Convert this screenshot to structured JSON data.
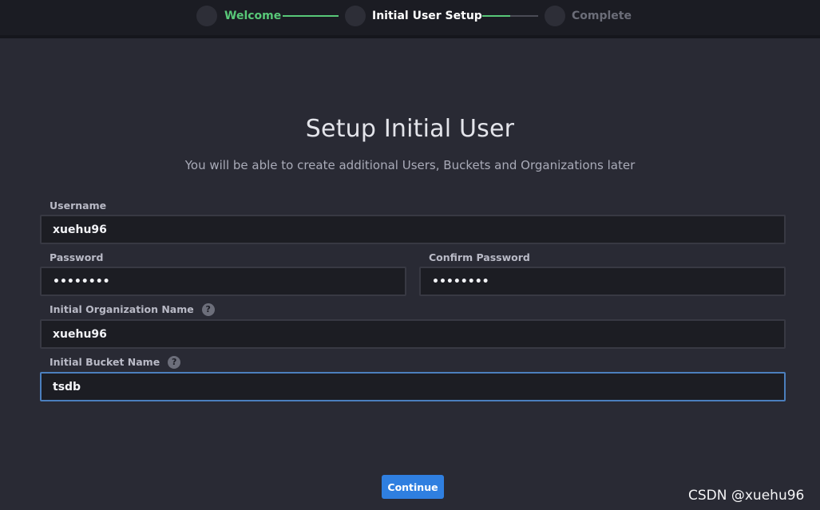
{
  "stepper": {
    "steps": [
      {
        "label": "Welcome",
        "state": "completed"
      },
      {
        "label": "Initial User Setup",
        "state": "current"
      },
      {
        "label": "Complete",
        "state": "pending"
      }
    ],
    "colors": {
      "completed": "#58c878",
      "current": "#ffffff",
      "pending": "#6b6d78",
      "line_done": "#58c878",
      "line_todo": "#4a4b55"
    }
  },
  "form": {
    "title": "Setup Initial User",
    "subtitle": "You will be able to create additional Users, Buckets and Organizations later",
    "username": {
      "label": "Username",
      "value": "xuehu96"
    },
    "password": {
      "label": "Password",
      "value": "••••••••"
    },
    "confirm_password": {
      "label": "Confirm Password",
      "value": "••••••••"
    },
    "organization": {
      "label": "Initial Organization Name",
      "value": "xuehu96",
      "help_icon": "question-circle-icon"
    },
    "bucket": {
      "label": "Initial Bucket Name",
      "value": "tsdb",
      "help_icon": "question-circle-icon"
    },
    "continue_label": "Continue",
    "accent_color": "#2f7fe0"
  },
  "watermark": "CSDN @xuehu96"
}
